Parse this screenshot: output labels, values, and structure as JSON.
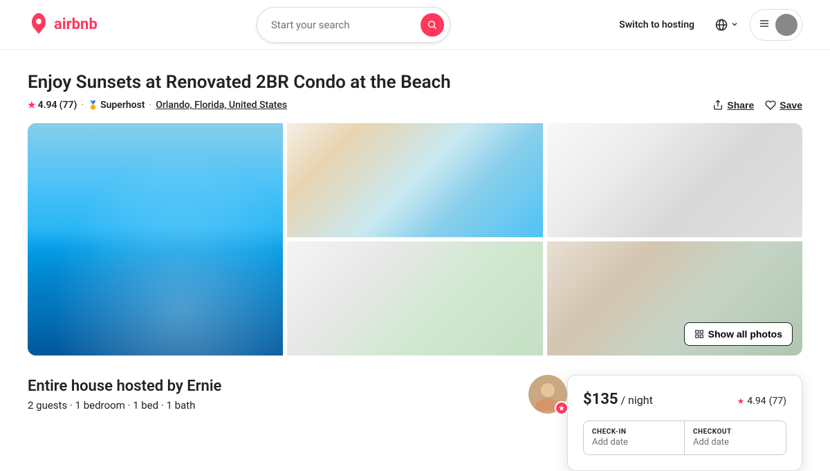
{
  "header": {
    "logo_text": "airbnb",
    "search_placeholder": "Start your search",
    "switch_hosting": "Switch to hosting",
    "menu_aria": "Menu and user profile"
  },
  "listing": {
    "title": "Enjoy Sunsets at Renovated 2BR Condo at the Beach",
    "rating": "4.94",
    "review_count": "77",
    "superhost_label": "Superhost",
    "location": "Orlando, Florida, United States",
    "share_label": "Share",
    "save_label": "Save",
    "show_all_photos": "Show all photos"
  },
  "host": {
    "title": "Entire house hosted by Ernie",
    "details": "2 guests · 1 bedroom · 1 bed · 1 bath"
  },
  "booking": {
    "price": "$135",
    "per_night": "/ night",
    "rating": "4.94",
    "review_count": "77",
    "checkin_label": "CHECK-IN",
    "checkout_label": "CHECKOUT",
    "checkin_value": "",
    "checkout_value": ""
  }
}
